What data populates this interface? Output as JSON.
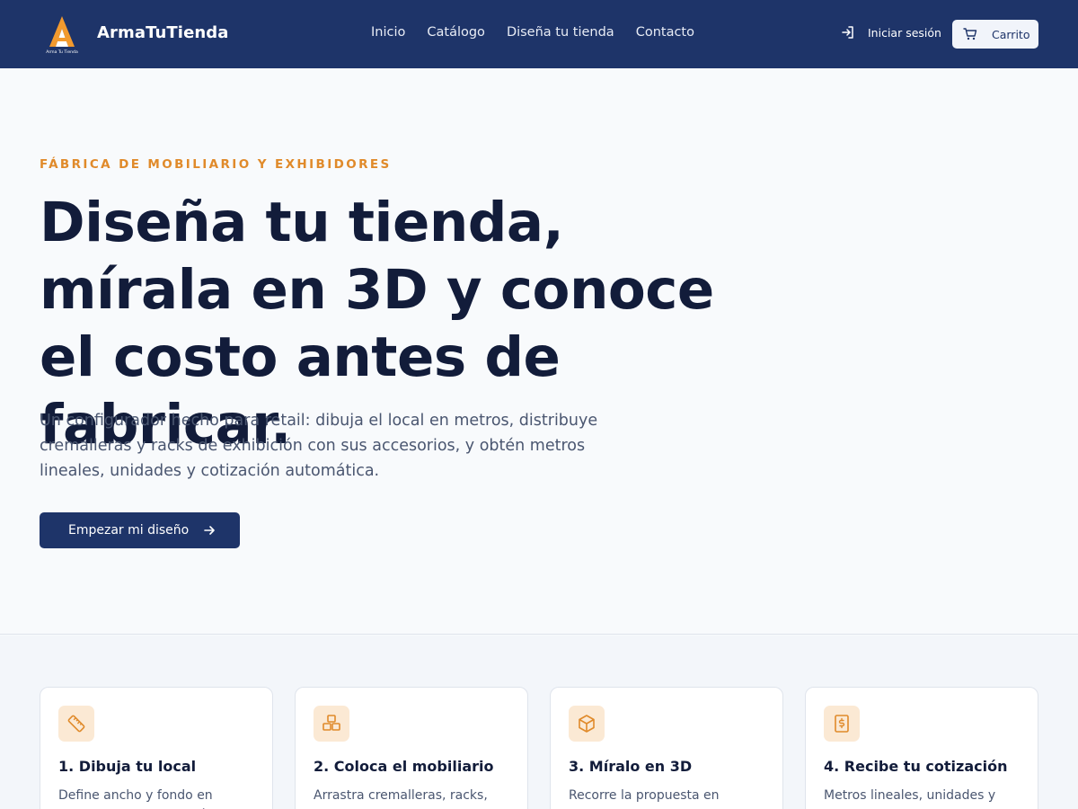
{
  "header": {
    "brand": "ArmaTuTienda",
    "logo_text": "Arma Tu Tienda",
    "nav": [
      "Inicio",
      "Catálogo",
      "Diseña tu tienda",
      "Contacto"
    ],
    "login_label": "Iniciar sesión",
    "cart_label": "Carrito"
  },
  "hero": {
    "eyebrow": "FÁBRICA DE MOBILIARIO Y EXHIBIDORES",
    "title": "Diseña tu tienda, mírala en 3D y conoce el costo antes de fabricar.",
    "lead": "Un configurador hecho para retail: dibuja el local en metros, distribuye cremalleras y racks de exhibición con sus accesorios, y obtén metros lineales, unidades y cotización automática.",
    "cta_label": "Empezar mi diseño"
  },
  "features": [
    {
      "icon": "ruler-icon",
      "title": "1. Dibuja tu local",
      "text": "Define ancho y fondo en metros, o mueve los vértices para"
    },
    {
      "icon": "boxes-icon",
      "title": "2. Coloca el mobiliario",
      "text": "Arrastra cremalleras, racks, repisas y accesorios; se pegan"
    },
    {
      "icon": "cube-icon",
      "title": "3. Míralo en 3D",
      "text": "Recorre la propuesta en volumen para validar alturas"
    },
    {
      "icon": "receipt-dollar-icon",
      "title": "4. Recibe tu cotización",
      "text": "Metros lineales, unidades y precio estimado en tiempo real"
    }
  ],
  "colors": {
    "header_bg": "#1e3469",
    "accent": "#e08a2a",
    "icon_tile_bg": "#fbe9d4",
    "title_text": "#121c3a"
  }
}
